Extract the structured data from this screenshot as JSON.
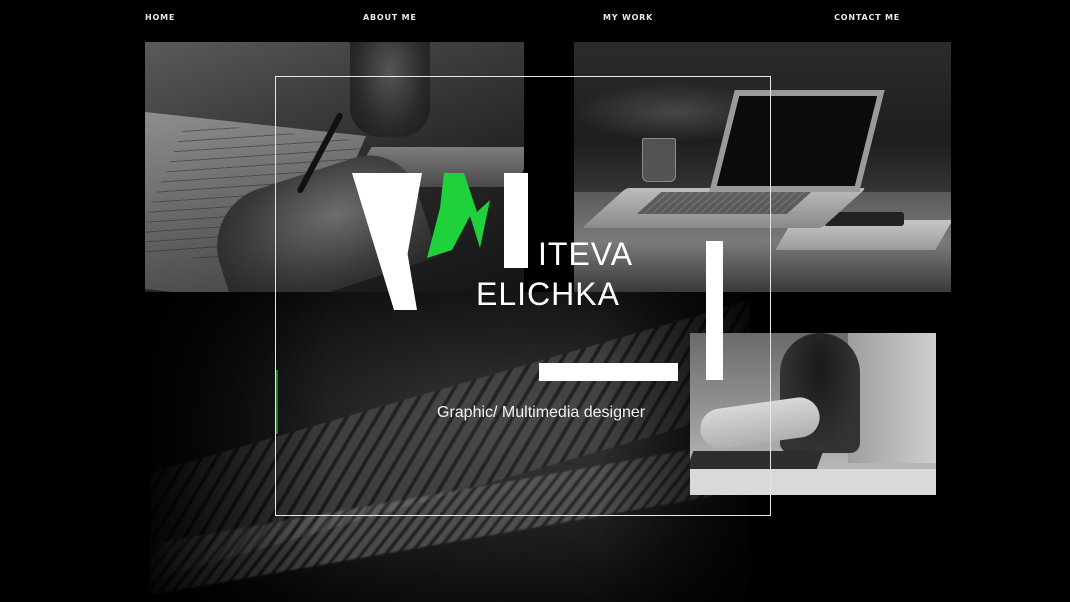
{
  "nav": {
    "home": "HOME",
    "about": "ABOUT ME",
    "work": "MY WORK",
    "contact": "CONTACT ME"
  },
  "brand": {
    "surname": "ITEVA",
    "first_name": "ELICHKA",
    "tagline": "Graphic/ Multimedia designer",
    "accent_color": "#1fd13a",
    "text_color": "#ffffff",
    "background_color": "#000000"
  }
}
